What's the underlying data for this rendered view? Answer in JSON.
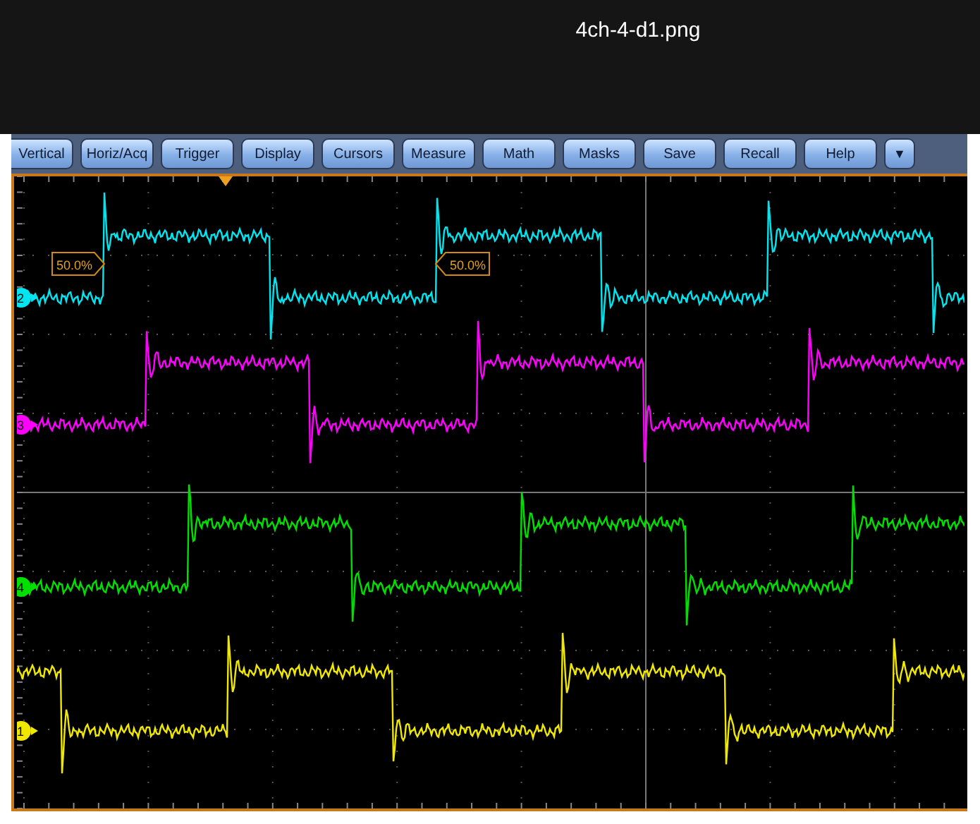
{
  "window": {
    "title": "4ch-4-d1.png"
  },
  "menu": [
    "Vertical",
    "Horiz/Acq",
    "Trigger",
    "Display",
    "Cursors",
    "Measure",
    "Math",
    "Masks",
    "Save",
    "Recall",
    "Help"
  ],
  "menu_more": "▼",
  "cursor_labels": [
    {
      "text": "50.0%",
      "kind": "pointright"
    },
    {
      "text": "50.0%",
      "kind": "pointleft"
    }
  ],
  "channels": [
    {
      "label": "2",
      "color": "#00e5f0"
    },
    {
      "label": "3",
      "color": "#ff00ff"
    },
    {
      "label": "4",
      "color": "#00e000"
    },
    {
      "label": "1",
      "color": "#f0e800"
    }
  ]
}
